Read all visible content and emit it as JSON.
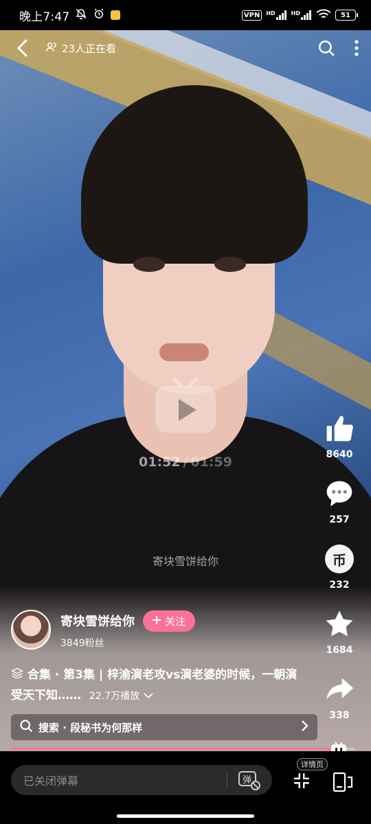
{
  "status_bar": {
    "time": "晚上7:47",
    "vpn": "VPN",
    "signal1": "HD",
    "signal2": "HD",
    "battery": "51"
  },
  "top_bar": {
    "watching": "23人正在看"
  },
  "player": {
    "current_time": "01:52",
    "separator": "/",
    "total_time": "01:59",
    "progress_percent": 94,
    "subtitle": "寄块雪饼给你"
  },
  "actions": {
    "like_count": "8640",
    "comment_count": "257",
    "coin_count": "232",
    "coin_glyph": "币",
    "favorite_count": "1684",
    "share_count": "338"
  },
  "author": {
    "name": "寄块雪饼给你",
    "follow_label": "关注",
    "fans": "3849粉丝"
  },
  "description": {
    "text": "合集 · 第3集 | 梓渝演老攻vs演老婆的时候，一朝演受天下知……",
    "plays": "22.7万播放"
  },
  "search_suggestion": {
    "label": "搜索 · 段秘书为何那样"
  },
  "bottom_bar": {
    "danmaku_placeholder": "已关闭弹幕",
    "detail_tag": "详情页"
  },
  "colors": {
    "accent": "#fb7299",
    "bar_bg": "#000000"
  }
}
